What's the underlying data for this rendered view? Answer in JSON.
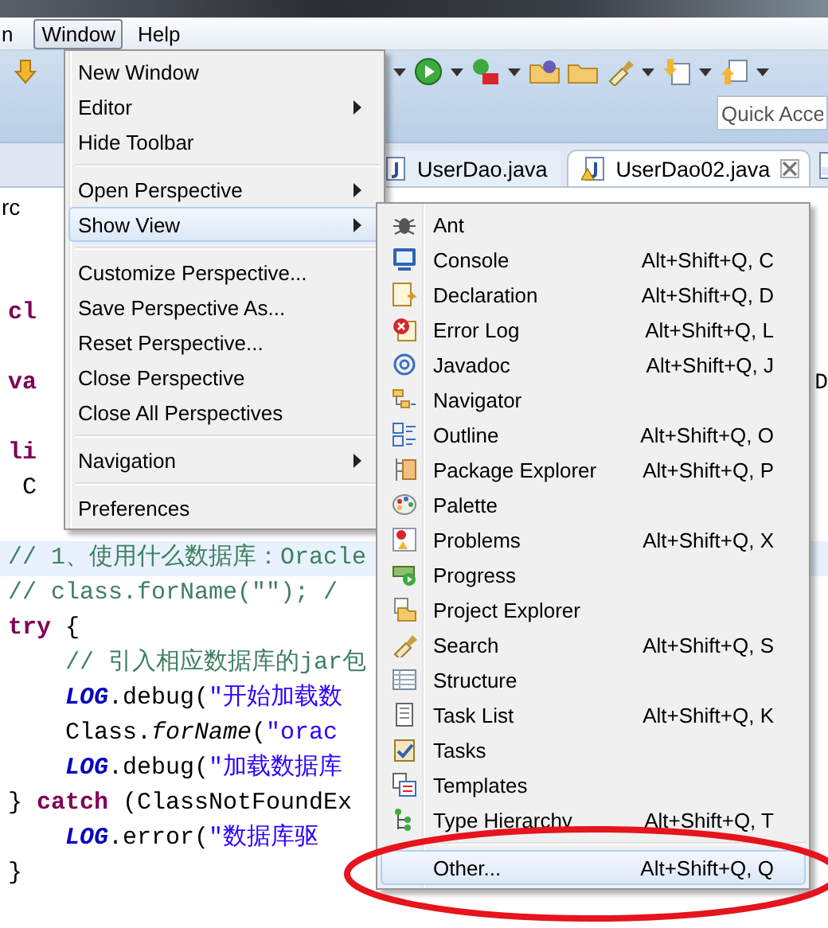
{
  "menu_bar": [
    {
      "label": "n",
      "selected": false
    },
    {
      "label": "Window",
      "selected": true
    },
    {
      "label": "Help",
      "selected": false
    }
  ],
  "toolbar": {
    "quick_access": {
      "placeholder": "Quick Acce"
    }
  },
  "editor_tabs": [
    {
      "label": "UserDao.java",
      "selected": false,
      "closable": false
    },
    {
      "label": "UserDao02.java",
      "selected": true,
      "closable": true
    }
  ],
  "breadcrumb": "rc",
  "code_lines": [
    {
      "highlighted": false
    },
    {
      "highlighted": false
    },
    {
      "highlighted": false,
      "segments": [
        {
          "kind": "keyword",
          "text": "cl"
        }
      ]
    },
    {
      "highlighted": false
    },
    {
      "highlighted": false,
      "segments": [
        {
          "kind": "keyword",
          "text": "va"
        }
      ],
      "edge_text": "D"
    },
    {
      "highlighted": false
    },
    {
      "highlighted": false,
      "segments": [
        {
          "kind": "keyword",
          "text": "li"
        }
      ]
    },
    {
      "highlighted": false,
      "segments": [
        {
          "kind": "plain",
          "text": " C"
        }
      ]
    },
    {
      "highlighted": false
    },
    {
      "highlighted": true,
      "segments": [
        {
          "kind": "comment",
          "text": "// 1、使用什么数据库：Oracle"
        }
      ]
    },
    {
      "highlighted": false,
      "segments": [
        {
          "kind": "comment",
          "text": "// class.forName(\"\"); /"
        }
      ]
    },
    {
      "highlighted": false,
      "segments": [
        {
          "kind": "keyword",
          "text": "try"
        },
        {
          "kind": "plain",
          "text": " {"
        }
      ]
    },
    {
      "highlighted": false,
      "segments": [
        {
          "kind": "comment",
          "text": "    // 引入相应数据库的jar包"
        }
      ]
    },
    {
      "highlighted": false,
      "segments": [
        {
          "kind": "field",
          "text": "    LOG"
        },
        {
          "kind": "plain",
          "text": ".debug("
        },
        {
          "kind": "string",
          "text": "\"开始加载数"
        }
      ]
    },
    {
      "highlighted": false,
      "segments": [
        {
          "kind": "plain",
          "text": "    Class."
        },
        {
          "kind": "static_method",
          "text": "forName"
        },
        {
          "kind": "plain",
          "text": "("
        },
        {
          "kind": "string",
          "text": "\"orac"
        }
      ]
    },
    {
      "highlighted": false,
      "segments": [
        {
          "kind": "field",
          "text": "    LOG"
        },
        {
          "kind": "plain",
          "text": ".debug("
        },
        {
          "kind": "string",
          "text": "\"加载数据库"
        }
      ]
    },
    {
      "highlighted": false,
      "segments": [
        {
          "kind": "plain",
          "text": "} "
        },
        {
          "kind": "keyword",
          "text": "catch"
        },
        {
          "kind": "plain",
          "text": " (ClassNotFoundEx"
        }
      ]
    },
    {
      "highlighted": false,
      "segments": [
        {
          "kind": "field",
          "text": "    LOG"
        },
        {
          "kind": "plain",
          "text": ".error("
        },
        {
          "kind": "string",
          "text": "\"数据库驱"
        }
      ]
    },
    {
      "highlighted": false,
      "segments": [
        {
          "kind": "plain",
          "text": "}"
        }
      ]
    }
  ],
  "window_menu": {
    "items": [
      {
        "kind": "item",
        "label": "New Window",
        "has_submenu": false,
        "selected": false
      },
      {
        "kind": "item",
        "label": "Editor",
        "has_submenu": true,
        "selected": false
      },
      {
        "kind": "item",
        "label": "Hide Toolbar",
        "has_submenu": false,
        "selected": false
      },
      {
        "kind": "separator"
      },
      {
        "kind": "item",
        "label": "Open Perspective",
        "has_submenu": true,
        "selected": false
      },
      {
        "kind": "item",
        "label": "Show View",
        "has_submenu": true,
        "selected": true
      },
      {
        "kind": "separator"
      },
      {
        "kind": "item",
        "label": "Customize Perspective...",
        "has_submenu": false,
        "selected": false
      },
      {
        "kind": "item",
        "label": "Save Perspective As...",
        "has_submenu": false,
        "selected": false
      },
      {
        "kind": "item",
        "label": "Reset Perspective...",
        "has_submenu": false,
        "selected": false
      },
      {
        "kind": "item",
        "label": "Close Perspective",
        "has_submenu": false,
        "selected": false
      },
      {
        "kind": "item",
        "label": "Close All Perspectives",
        "has_submenu": false,
        "selected": false
      },
      {
        "kind": "separator"
      },
      {
        "kind": "item",
        "label": "Navigation",
        "has_submenu": true,
        "selected": false
      },
      {
        "kind": "separator"
      },
      {
        "kind": "item",
        "label": "Preferences",
        "has_submenu": false,
        "selected": false
      }
    ]
  },
  "show_view_menu": {
    "items": [
      {
        "kind": "item",
        "label": "Ant",
        "selected": false
      },
      {
        "kind": "item",
        "label": "Console",
        "shortcut": "Alt+Shift+Q, C",
        "selected": false
      },
      {
        "kind": "item",
        "label": "Declaration",
        "shortcut": "Alt+Shift+Q, D",
        "selected": false
      },
      {
        "kind": "item",
        "label": "Error Log",
        "shortcut": "Alt+Shift+Q, L",
        "selected": false
      },
      {
        "kind": "item",
        "label": "Javadoc",
        "shortcut": "Alt+Shift+Q, J",
        "selected": false
      },
      {
        "kind": "item",
        "label": "Navigator",
        "selected": false
      },
      {
        "kind": "item",
        "label": "Outline",
        "shortcut": "Alt+Shift+Q, O",
        "selected": false
      },
      {
        "kind": "item",
        "label": "Package Explorer",
        "shortcut": "Alt+Shift+Q, P",
        "selected": false
      },
      {
        "kind": "item",
        "label": "Palette",
        "selected": false
      },
      {
        "kind": "item",
        "label": "Problems",
        "shortcut": "Alt+Shift+Q, X",
        "selected": false
      },
      {
        "kind": "item",
        "label": "Progress",
        "selected": false
      },
      {
        "kind": "item",
        "label": "Project Explorer",
        "selected": false
      },
      {
        "kind": "item",
        "label": "Search",
        "shortcut": "Alt+Shift+Q, S",
        "selected": false
      },
      {
        "kind": "item",
        "label": "Structure",
        "selected": false
      },
      {
        "kind": "item",
        "label": "Task List",
        "shortcut": "Alt+Shift+Q, K",
        "selected": false
      },
      {
        "kind": "item",
        "label": "Tasks",
        "selected": false
      },
      {
        "kind": "item",
        "label": "Templates",
        "selected": false
      },
      {
        "kind": "item",
        "label": "Type Hierarchy",
        "shortcut": "Alt+Shift+Q, T",
        "selected": false
      },
      {
        "kind": "separator"
      },
      {
        "kind": "item",
        "label": "Other...",
        "shortcut": "Alt+Shift+Q, Q",
        "selected": true
      }
    ]
  }
}
